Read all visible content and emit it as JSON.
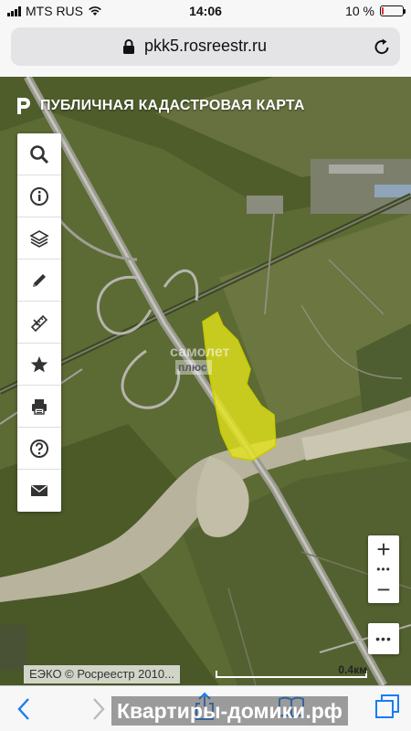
{
  "status_bar": {
    "carrier": "MTS RUS",
    "time": "14:06",
    "battery_percent_label": "10 %",
    "battery_level": 0.1
  },
  "browser": {
    "url": "pkk5.rosreestr.ru"
  },
  "map": {
    "brand_title": "ПУБЛИЧНАЯ КАДАСТРОВАЯ КАРТА",
    "tools": [
      {
        "name": "search-icon",
        "label": "search"
      },
      {
        "name": "info-icon",
        "label": "info"
      },
      {
        "name": "layers-icon",
        "label": "layers"
      },
      {
        "name": "pencil-icon",
        "label": "draw"
      },
      {
        "name": "ruler-icon",
        "label": "measure"
      },
      {
        "name": "star-icon",
        "label": "favorites"
      },
      {
        "name": "printer-icon",
        "label": "print"
      },
      {
        "name": "help-icon",
        "label": "help"
      },
      {
        "name": "mail-icon",
        "label": "feedback"
      }
    ],
    "zoom_in": "+",
    "zoom_out": "−",
    "more": "•••",
    "dots": "•••",
    "copyright": "ЕЭКО © Росреестр 2010...",
    "scale_label": "0.4км",
    "watermark_line1": "самолет",
    "watermark_line2": "плюс",
    "parcel_color": "#e6e619"
  },
  "footer": {
    "site_watermark": "Квартиры-домики.рф"
  }
}
